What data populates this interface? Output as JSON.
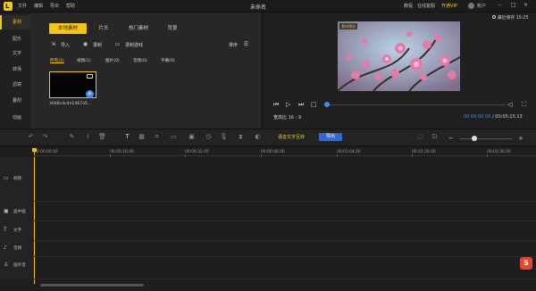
{
  "app": {
    "logo_char": "L",
    "menu": [
      "文件",
      "编辑",
      "导出",
      "帮助"
    ],
    "window_title": "未命名",
    "tutorial": "教程",
    "online": "在线客服",
    "vip": "开通VIP",
    "account": "账户",
    "win_min": "–",
    "win_max": "□",
    "win_close": "×"
  },
  "nav": {
    "items": [
      "素材",
      "配乐",
      "文字",
      "转场",
      "滤镜",
      "叠附",
      "动画"
    ],
    "active_index": 0
  },
  "library": {
    "tabs": [
      "本地素材",
      "片头",
      "热门素材",
      "背景"
    ],
    "active_tab": 0,
    "import_label": "导入",
    "record_label": "录制",
    "screen_record_label": "录制游戏",
    "sort_label": "排序",
    "filters": [
      "所有(1)",
      "视频(1)",
      "图片(0)",
      "音频(0)",
      "字幕(0)"
    ],
    "active_filter": 0,
    "clip_name": "3048c4c4e1467a5..."
  },
  "preview": {
    "badge": "素材预览",
    "ratio_label": "宽高比 16 : 9",
    "current_time": "00:00:00.00",
    "total_time": "00:05:15.13",
    "export_note": "最近保存 15:25",
    "progress": 0.0
  },
  "toolbar": {
    "subtitle_btn": "语音文字互转",
    "export_btn": "导出"
  },
  "timeline": {
    "ticks": [
      "00:00:00.00",
      "00:00:16.00",
      "00:00:32.00",
      "00:00:48.00",
      "00:01:04.00",
      "00:01:20.00",
      "00:01:36.00"
    ],
    "tracks": [
      {
        "label": "视频",
        "icon": "▭"
      },
      {
        "label": "画中画",
        "icon": "▣"
      },
      {
        "label": "文字",
        "icon": "T"
      },
      {
        "label": "音频",
        "icon": "♪"
      },
      {
        "label": "画外音",
        "icon": "♙"
      }
    ]
  },
  "badge": {
    "lang": "S"
  },
  "colors": {
    "accent": "#f5c518",
    "blue": "#3a8ff7",
    "export": "#2c6bd6"
  }
}
